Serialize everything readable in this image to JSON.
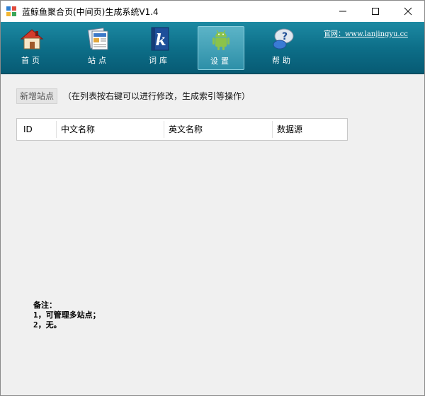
{
  "window": {
    "title": "蓝鲸鱼聚合页(中间页)生成系统V1.4"
  },
  "toolbar": {
    "items": [
      {
        "label": "首页",
        "icon": "house-icon"
      },
      {
        "label": "站点",
        "icon": "site-pages-icon"
      },
      {
        "label": "词库",
        "icon": "k-book-icon"
      },
      {
        "label": "设置",
        "icon": "android-icon",
        "selected": true
      },
      {
        "label": "帮助",
        "icon": "help-bubble-icon"
      }
    ],
    "site_link": "官网：www.lanjingyu.cc"
  },
  "main": {
    "add_button": "新增站点",
    "hint": "（在列表按右键可以进行修改，生成索引等操作）",
    "table": {
      "columns": [
        "ID",
        "中文名称",
        "英文名称",
        "数据源"
      ],
      "rows": []
    }
  },
  "notes": {
    "title": "备注：",
    "lines": [
      "1，可管理多站点；",
      "2，无。"
    ]
  }
}
